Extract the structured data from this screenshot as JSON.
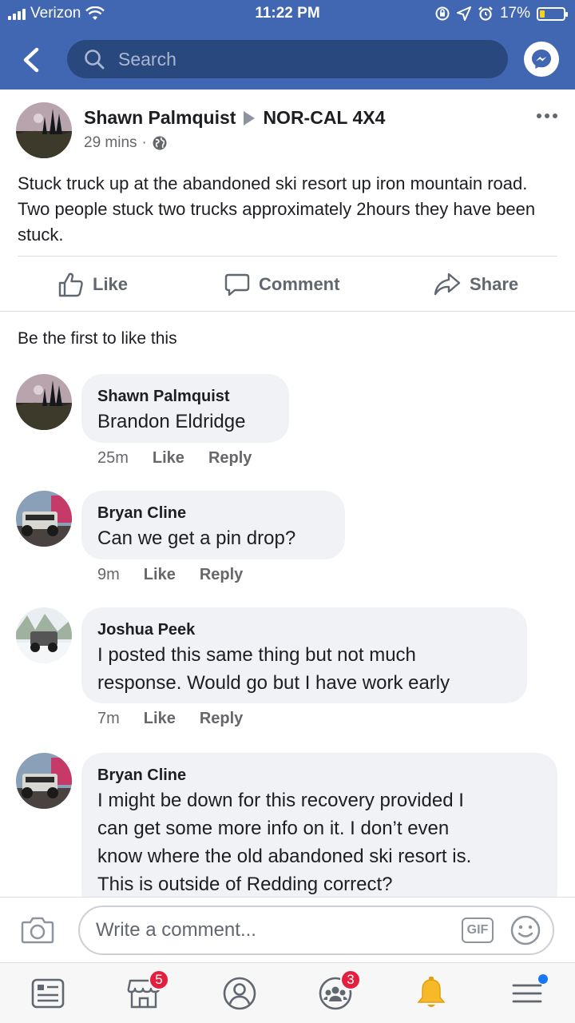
{
  "status_bar": {
    "carrier": "Verizon",
    "time": "11:22 PM",
    "battery": "17%"
  },
  "header": {
    "search_placeholder": "Search"
  },
  "post": {
    "author": "Shawn Palmquist",
    "group": "NOR-CAL 4X4",
    "time": "29 mins",
    "text": "Stuck truck up at the abandoned ski resort up iron mountain road. Two people stuck two trucks approximately 2hours they have been stuck.",
    "actions": {
      "like": "Like",
      "comment": "Comment",
      "share": "Share"
    },
    "likes_summary": "Be the first to like this"
  },
  "comments": [
    {
      "name": "Shawn Palmquist",
      "text": "Brandon Eldridge",
      "time": "25m",
      "like": "Like",
      "reply": "Reply"
    },
    {
      "name": "Bryan Cline",
      "text": "Can we get a pin drop?",
      "time": "9m",
      "like": "Like",
      "reply": "Reply"
    },
    {
      "name": "Joshua Peek",
      "text_lines": [
        "I posted this same thing but not much",
        "response. Would go but I have work early"
      ],
      "time": "7m",
      "like": "Like",
      "reply": "Reply"
    },
    {
      "name": "Bryan Cline",
      "text_lines": [
        "I might be down for this recovery provided I",
        "can get some more info on it. I don’t even",
        "know where the old abandoned ski resort is.",
        "This is outside of Redding correct?"
      ]
    }
  ],
  "composer": {
    "placeholder": "Write a comment...",
    "gif_label": "GIF"
  },
  "tabbar": {
    "marketplace_badge": "5",
    "groups_badge": "3"
  },
  "colors": {
    "brand": "#4267b2",
    "search_bg": "#29487d",
    "badge": "#e41e3f",
    "bubble": "#f0f2f5"
  }
}
